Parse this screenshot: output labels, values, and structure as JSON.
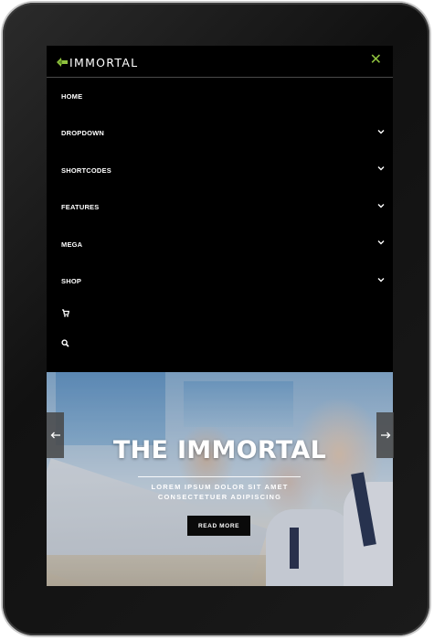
{
  "header": {
    "logo_text": "IMMORTAL",
    "close_icon": "close-icon",
    "accent_color": "#8fc23e"
  },
  "menu": {
    "items": [
      {
        "label": "HOME",
        "has_submenu": false
      },
      {
        "label": "DROPDOWN",
        "has_submenu": true
      },
      {
        "label": "SHORTCODES",
        "has_submenu": true
      },
      {
        "label": "FEATURES",
        "has_submenu": true
      },
      {
        "label": "MEGA",
        "has_submenu": true
      },
      {
        "label": "SHOP",
        "has_submenu": true
      }
    ],
    "icon_items": [
      "cart-icon",
      "search-icon"
    ]
  },
  "hero": {
    "title": "THE IMMORTAL",
    "subtitle_line1": "LOREM IPSUM DOLOR SIT AMET",
    "subtitle_line2": "CONSECTETUER ADIPISCING",
    "button_label": "READ MORE",
    "prev_icon": "arrow-left-icon",
    "next_icon": "arrow-right-icon"
  }
}
